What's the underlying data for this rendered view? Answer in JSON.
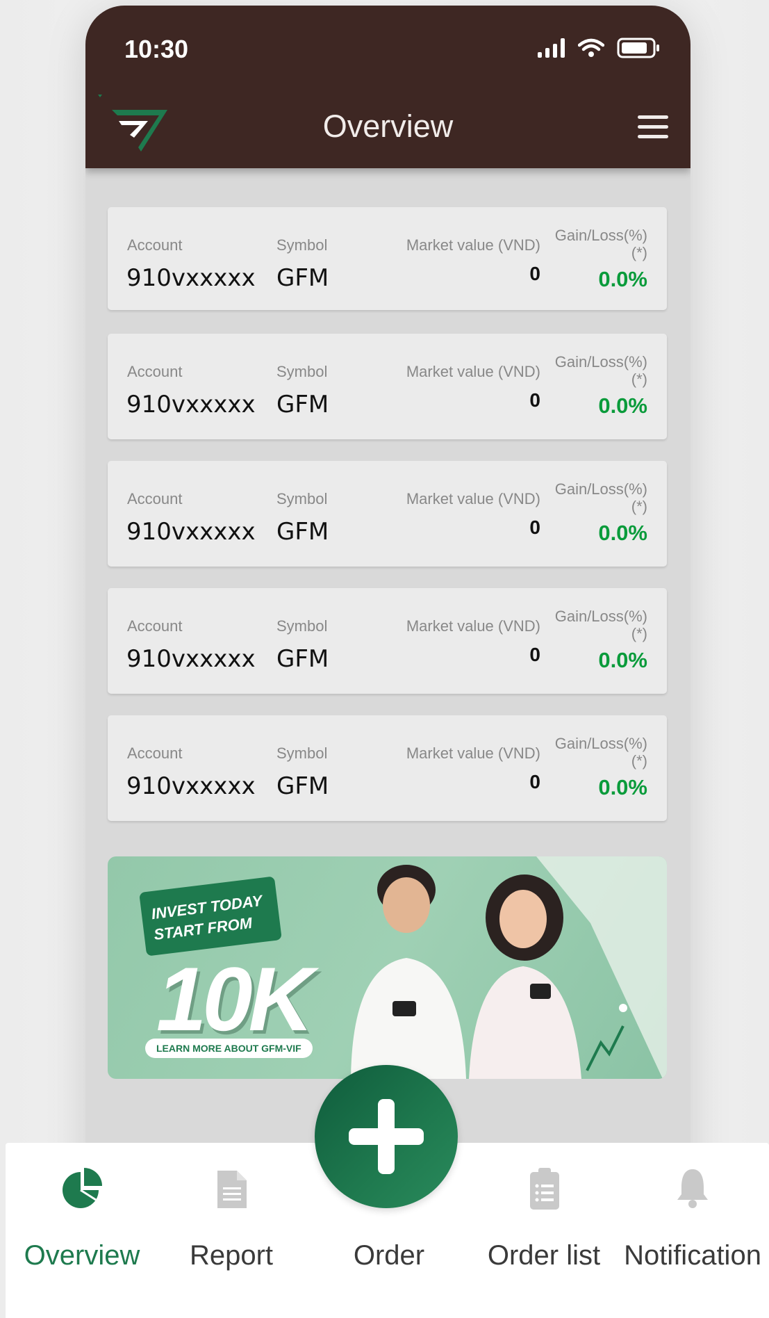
{
  "status_bar": {
    "time": "10:30"
  },
  "header": {
    "title": "Overview"
  },
  "labels": {
    "account": "Account",
    "symbol": "Symbol",
    "market_value": "Market value (VND)",
    "gain_loss": "Gain/Loss(%)",
    "gain_loss_note": "(*)"
  },
  "accounts": [
    {
      "account": "910vxxxxx",
      "symbol": "GFM",
      "market_value": "0",
      "gain_loss": "0.0%"
    },
    {
      "account": "910vxxxxx",
      "symbol": "GFM",
      "market_value": "0",
      "gain_loss": "0.0%"
    },
    {
      "account": "910vxxxxx",
      "symbol": "GFM",
      "market_value": "0",
      "gain_loss": "0.0%"
    },
    {
      "account": "910vxxxxx",
      "symbol": "GFM",
      "market_value": "0",
      "gain_loss": "0.0%"
    },
    {
      "account": "910vxxxxx",
      "symbol": "GFM",
      "market_value": "0",
      "gain_loss": "0.0%"
    }
  ],
  "banner": {
    "line1": "INVEST TODAY",
    "line2": "START FROM",
    "amount": "10K",
    "cta": "LEARN MORE ABOUT GFM-VIF"
  },
  "bottom_nav": {
    "items": [
      {
        "label": "Overview",
        "icon": "pie-chart-icon",
        "active": true
      },
      {
        "label": "Report",
        "icon": "document-icon",
        "active": false
      },
      {
        "label": "Order",
        "icon": "plus-icon",
        "active": false
      },
      {
        "label": "Order list",
        "icon": "clipboard-list-icon",
        "active": false
      },
      {
        "label": "Notification",
        "icon": "bell-icon",
        "active": false
      }
    ]
  },
  "colors": {
    "header_bg": "#3e2723",
    "brand_green": "#1e7a4e",
    "gain_green": "#0a9b3b",
    "card_bg": "#ebebeb"
  }
}
